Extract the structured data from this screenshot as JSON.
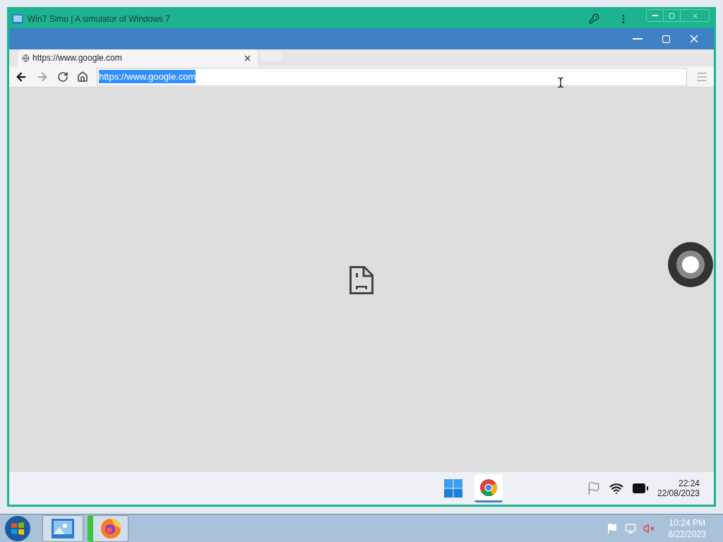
{
  "window": {
    "title": "Win7 Simu | A simulator of Windows 7"
  },
  "browser": {
    "tabs": [
      {
        "label": "https://www.google.com",
        "selected": true
      }
    ],
    "address": {
      "value": "https://www.google.com",
      "selected": true
    }
  },
  "inner_taskbar": {
    "apps": [
      {
        "kind": "start",
        "selected": false
      },
      {
        "kind": "chrome",
        "selected": true
      }
    ],
    "time": "22:24",
    "date": "22/08/2023"
  },
  "taskbar": {
    "items": [
      {
        "kind": "emulator",
        "selected": false
      },
      {
        "kind": "firefox",
        "selected": true
      }
    ],
    "time": "10:24 PM",
    "date": "8/22/2023"
  }
}
